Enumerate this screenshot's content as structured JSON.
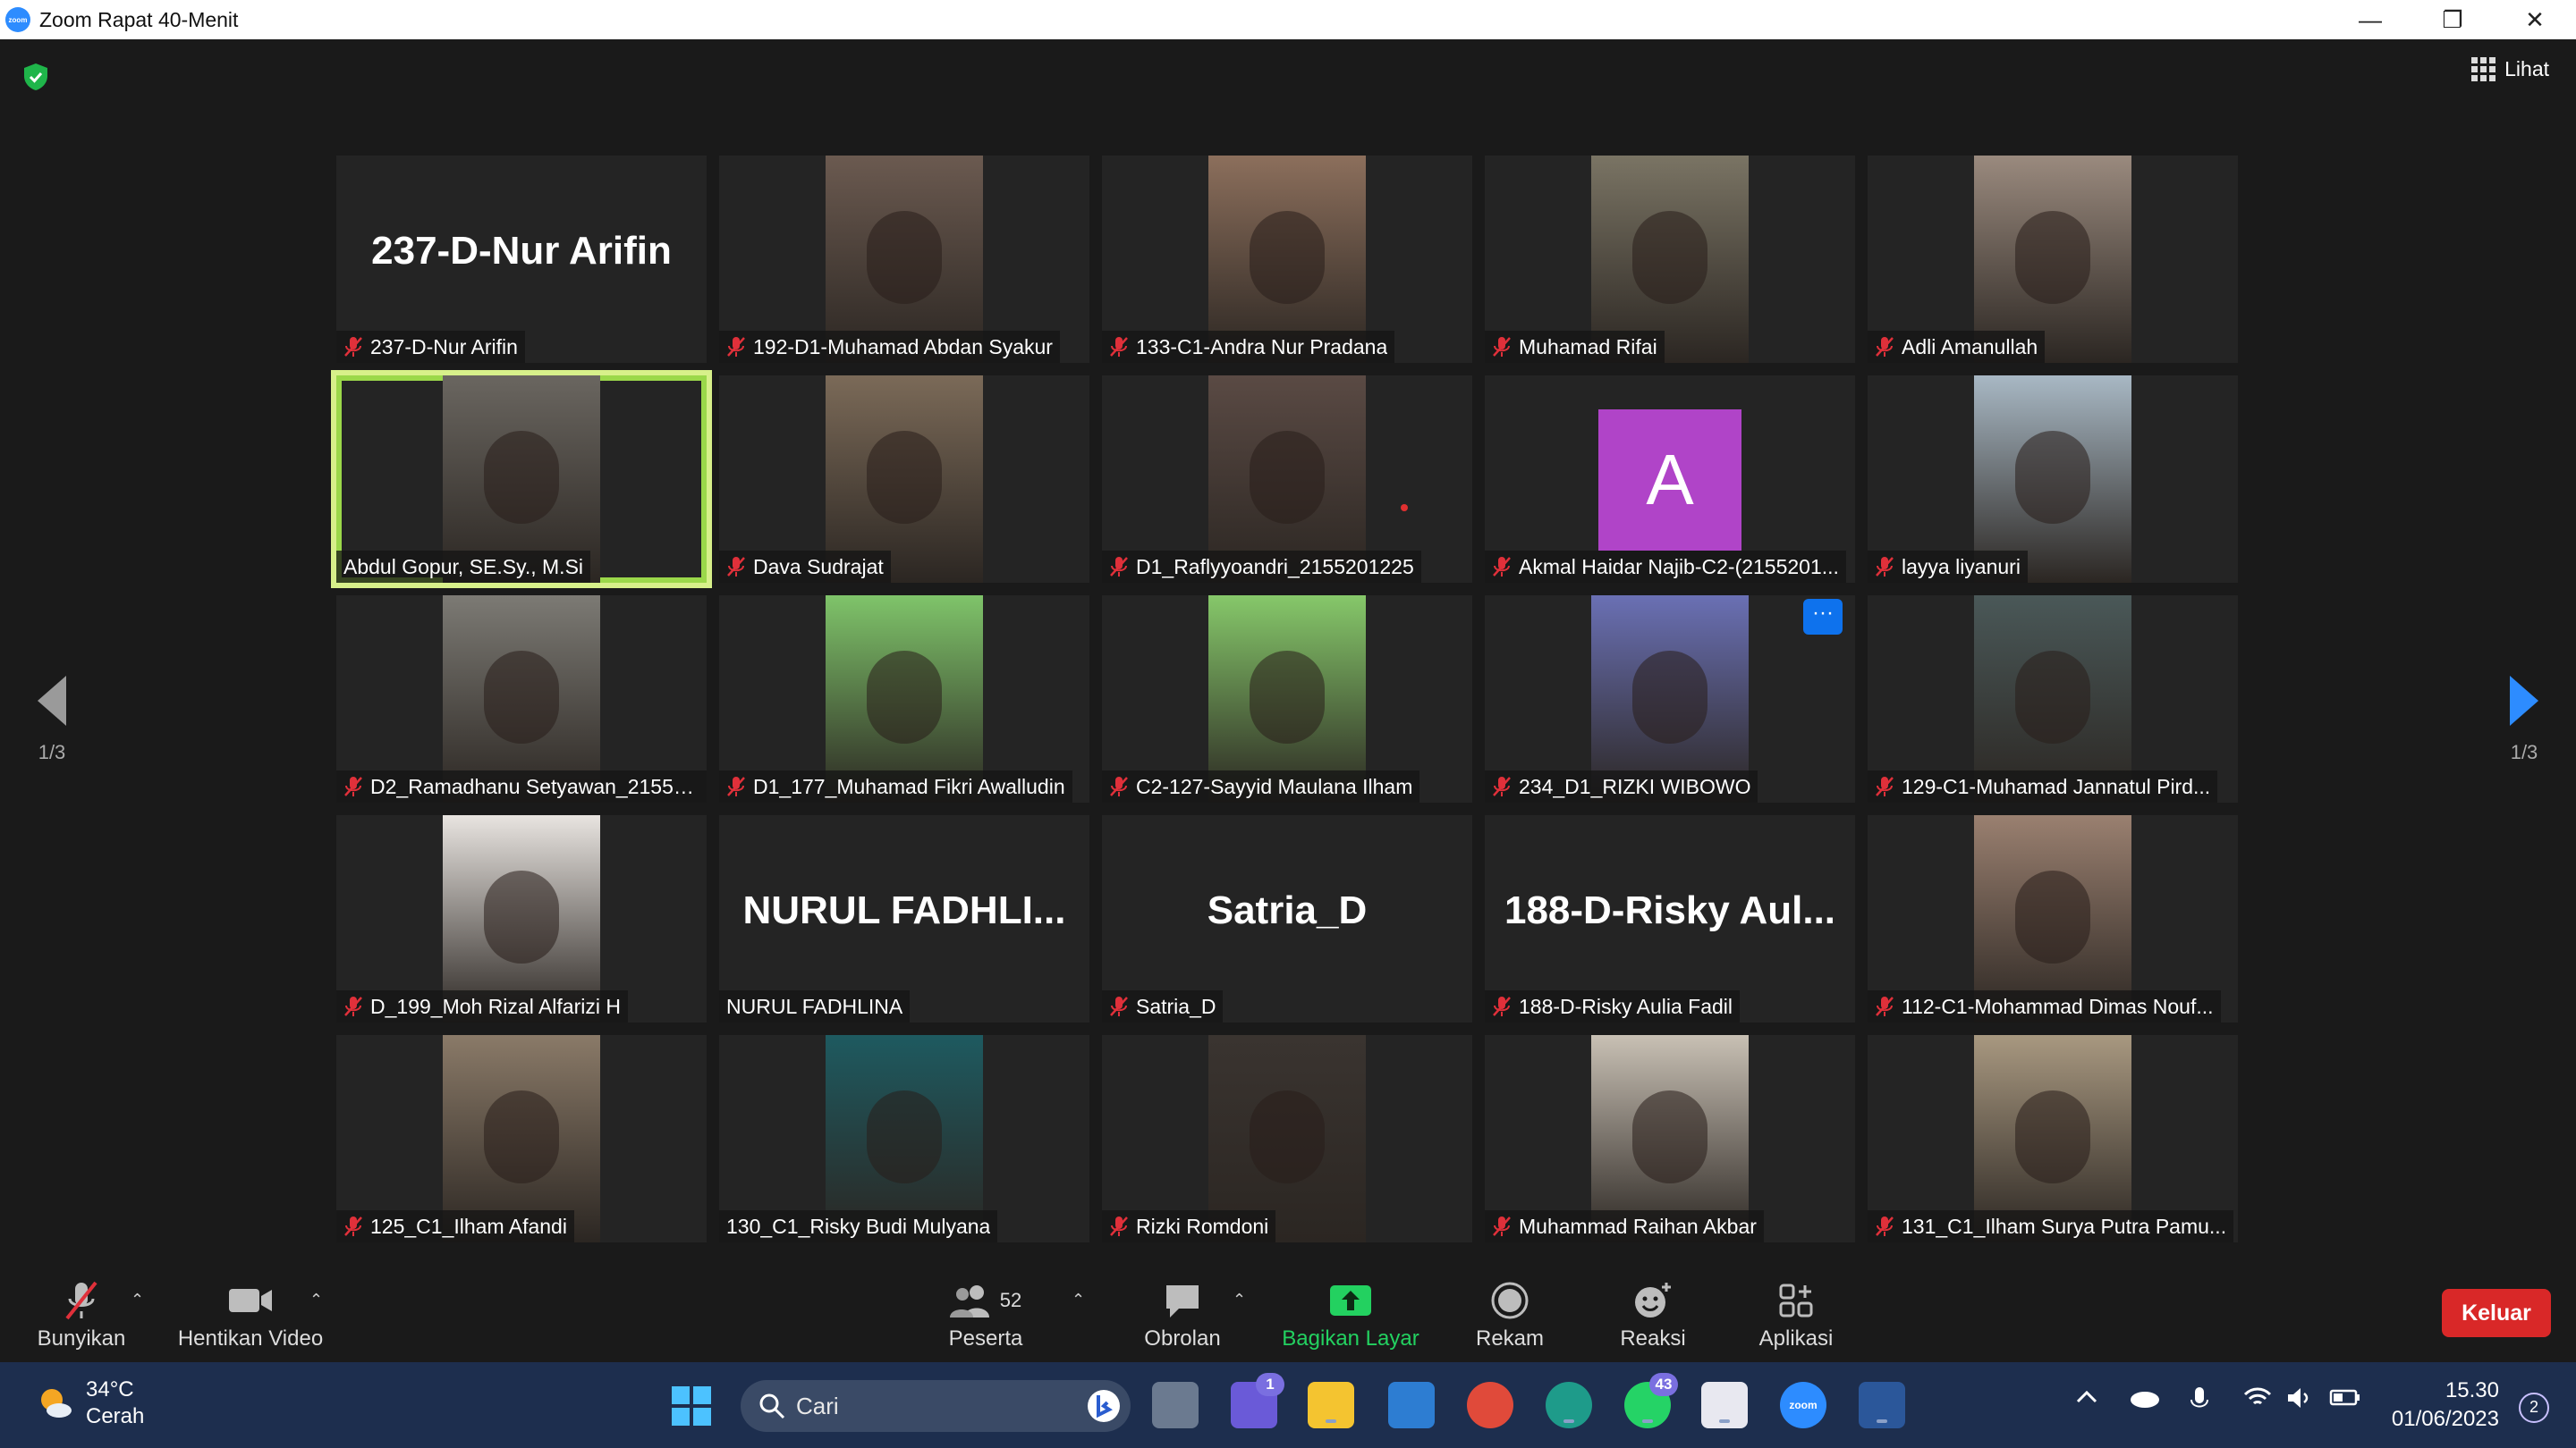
{
  "window": {
    "title": "Zoom Rapat 40-Menit",
    "minimize": "—",
    "restore": "❐",
    "close": "✕"
  },
  "view_button": {
    "label": "Lihat"
  },
  "pager": {
    "left": "1/3",
    "right": "1/3"
  },
  "tiles": [
    {
      "name": "237-D-Nur Arifin",
      "big": "237-D-Nur Arifin",
      "muted": true,
      "video": null
    },
    {
      "name": "192-D1-Muhamad Abdan Syakur",
      "muted": true,
      "video": "#6b5a50"
    },
    {
      "name": "133-C1-Andra Nur Pradana",
      "muted": true,
      "video": "#8c6f5c"
    },
    {
      "name": "Muhamad Rifai",
      "muted": true,
      "video": "#7a7464"
    },
    {
      "name": "Adli Amanullah",
      "muted": true,
      "video": "#9a8a7e"
    },
    {
      "name": "Abdul Gopur, SE.Sy., M.Si",
      "muted": false,
      "active": true,
      "video": "#6a6660"
    },
    {
      "name": "Dava Sudrajat",
      "muted": true,
      "video": "#7b6a58"
    },
    {
      "name": "D1_Raflyyoandri_2155201225",
      "muted": true,
      "video": "#5a4a44"
    },
    {
      "name": "Akmal Haidar Najib-C2-(2155201...",
      "muted": true,
      "avatar": "A"
    },
    {
      "name": "layya liyanuri",
      "muted": true,
      "video": "#a8b8c4"
    },
    {
      "name": "D2_Ramadhanu Setyawan_21552...",
      "muted": true,
      "video": "#7c7a74"
    },
    {
      "name": "D1_177_Muhamad Fikri Awalludin",
      "muted": true,
      "video": "#7fc46a"
    },
    {
      "name": "C2-127-Sayyid Maulana Ilham",
      "muted": true,
      "video": "#86c86a"
    },
    {
      "name": "234_D1_RIZKI WIBOWO",
      "muted": true,
      "video": "#6a70b4",
      "more": "···"
    },
    {
      "name": "129-C1-Muhamad Jannatul Pird...",
      "muted": true,
      "video": "#4a5858"
    },
    {
      "name": "D_199_Moh Rizal Alfarizi H",
      "muted": true,
      "video": "#e8e4e0"
    },
    {
      "name": "NURUL FADHLINA",
      "big": "NURUL FADHLI...",
      "muted": false,
      "video": null
    },
    {
      "name": "Satria_D",
      "big": "Satria_D",
      "muted": true,
      "video": null
    },
    {
      "name": "188-D-Risky Aulia Fadil",
      "big": "188-D-Risky Aul...",
      "muted": true,
      "video": null
    },
    {
      "name": "112-C1-Mohammad Dimas Nouf...",
      "muted": true,
      "video": "#9a8070"
    },
    {
      "name": "125_C1_Ilham Afandi",
      "muted": true,
      "video": "#8a7a68"
    },
    {
      "name": "130_C1_Risky Budi Mulyana",
      "muted": false,
      "video": "#1e5a60"
    },
    {
      "name": "Rizki Romdoni",
      "muted": true,
      "video": "#3a3430"
    },
    {
      "name": "Muhammad Raihan Akbar",
      "muted": true,
      "video": "#c8c0b4"
    },
    {
      "name": "131_C1_Ilham Surya Putra Pamu...",
      "muted": true,
      "video": "#a89880"
    }
  ],
  "toolbar": {
    "unmute": "Bunyikan",
    "stop_video": "Hentikan Video",
    "participants": "Peserta",
    "participants_count": "52",
    "chat": "Obrolan",
    "share": "Bagikan Layar",
    "record": "Rekam",
    "reactions": "Reaksi",
    "apps": "Aplikasi",
    "leave": "Keluar",
    "caret": "⌃"
  },
  "taskbar": {
    "temp": "34°C",
    "weather": "Cerah",
    "search": "Cari",
    "teams_badge": "1",
    "whatsapp_badge": "43",
    "zoom_label": "zoom",
    "time": "15.30",
    "date": "01/06/2023",
    "notifications": "2"
  },
  "colors": {
    "accent": "#2d8cff",
    "share": "#23d160",
    "leave": "#d92828",
    "active_border": "#d7f08a",
    "muted_mic": "#e0303a"
  }
}
